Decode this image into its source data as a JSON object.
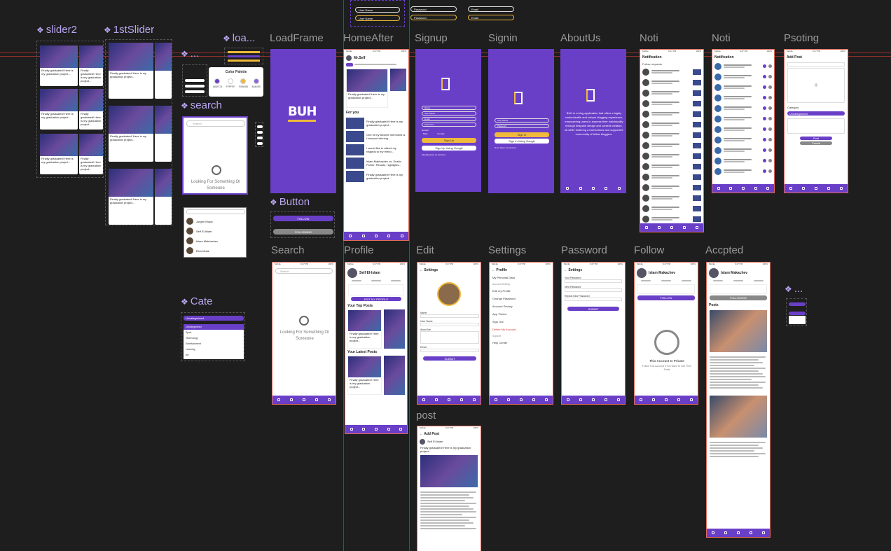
{
  "frames": {
    "slider2": "slider2",
    "first_slider": "1stSlider",
    "loading": "loa...",
    "component_dots": "...",
    "search_component": "search",
    "button_component": "Button",
    "cate_component": "Cate",
    "load_frame": "LoadFrame",
    "home_after": "HomeAfter",
    "signup": "Signup",
    "signin": "Signin",
    "about_us": "AboutUs",
    "noti_1": "Noti",
    "noti_2": "Noti",
    "posting": "Psoting",
    "search": "Search",
    "profile": "Profile",
    "edit": "Edit",
    "settings": "Settings",
    "password": "Password",
    "follow": "Follow",
    "accepted": "Accpted",
    "post": "post",
    "right_dots": "..."
  },
  "top_inputs": {
    "user_name": "User Name",
    "password": "Password",
    "email": "Email"
  },
  "palette": {
    "title": "Color Palette",
    "swatches": [
      {
        "label": "6A3FC8",
        "color": "#6A3FC8"
      },
      {
        "label": "FFFFFF",
        "color": "#FFFFFF"
      },
      {
        "label": "F0B93B",
        "color": "#F0B93B"
      },
      {
        "label": "8A64E0",
        "color": "#8A64E0"
      }
    ]
  },
  "brand": {
    "logo_text": "BUH"
  },
  "app": {
    "status_left": "Mobile",
    "status_time": "9:27 PM",
    "status_right": "100%",
    "home_user": "Mr.Self",
    "for_you": "For you",
    "post_title": "Finally graduated! Here is my graduation project...",
    "post_title_2": "One of my favorite memories is Liverpool winning...",
    "post_title_3": "I would like to attend my regards to my friend...",
    "post_title_4": "Islam Makhachev vs. Dustin Poirier: Results, highlights...",
    "search_placeholder": "Search",
    "search_empty": "Looking For Something Or Someone",
    "buttons": {
      "follow": "FOLLOW",
      "following": "FOLLOWING"
    },
    "signup_fields": [
      "Name",
      "User Name",
      "Email",
      "Password"
    ],
    "gender": "Gender",
    "male": "Male",
    "female": "Female",
    "sign_up": "Sign Up",
    "sign_up_google": "Sign Up Using Google",
    "have_account": "Already Have an Account",
    "signin_fields": [
      "User Name",
      "Password"
    ],
    "sign_in": "Sign In",
    "sign_in_google": "Sign In Using Google",
    "no_account": "Don't Have an Account",
    "about_text": "BUH is a blog application that offers a highly customizable and unique blogging experience, empowering users to express their individuality through bespoke design and content creation, all while fostering a harmonious and supportive community of fellow bloggers.",
    "notification": "Notification",
    "follow_requests": "Follow requests",
    "add_post": "Add Post",
    "category": "Category",
    "post_btn": "Post",
    "cancel_btn": "Cancel",
    "profile_name": "Self El-Islam",
    "edit_profile": "EDIT MY PROFILE",
    "top_posts": "Your Top Posts",
    "latest_posts": "Your Latest Posts",
    "settings": "Settings",
    "edit_fields": [
      "Name",
      "User Name",
      "About Me",
      "Email"
    ],
    "submit": "SUBMIT",
    "profile": "Profile",
    "my_personal_data": "My Personal Data",
    "account_setting": "Account Setting",
    "edit_my_profile": "Edit my Profile",
    "change_password": "Change Password",
    "account_privacy": "Account Privacy",
    "app_theme": "App Theme",
    "sign_out": "Sign Out",
    "delete_account": "Delete My Account",
    "support": "Support",
    "help_center": "Help Center",
    "password_fields": [
      "Your Password",
      "New Password",
      "Repeat New Password"
    ],
    "follow_name": "Islam Makachev",
    "private_title": "This Account Is Private",
    "private_sub": "Follow This Account If You Want To See Their Posts",
    "posts": "Posts",
    "nav": [
      "Home",
      "Search",
      "Add post",
      "Profile",
      "About Us"
    ]
  },
  "cate_items": [
    "Uncategorized",
    "Sport",
    "Technology",
    "Entertainment",
    "Learning",
    "Art"
  ],
  "search_list": [
    "Jurgen Klopp",
    "Self El-Islam",
    "Islam Makhachev",
    "Elon Musk"
  ],
  "colors": {
    "canvas": "#1E1E1E",
    "accent": "#6A3FC8",
    "yellow": "#F0B93B",
    "guide": "#B2332E",
    "component_label": "#B9A6F0"
  }
}
